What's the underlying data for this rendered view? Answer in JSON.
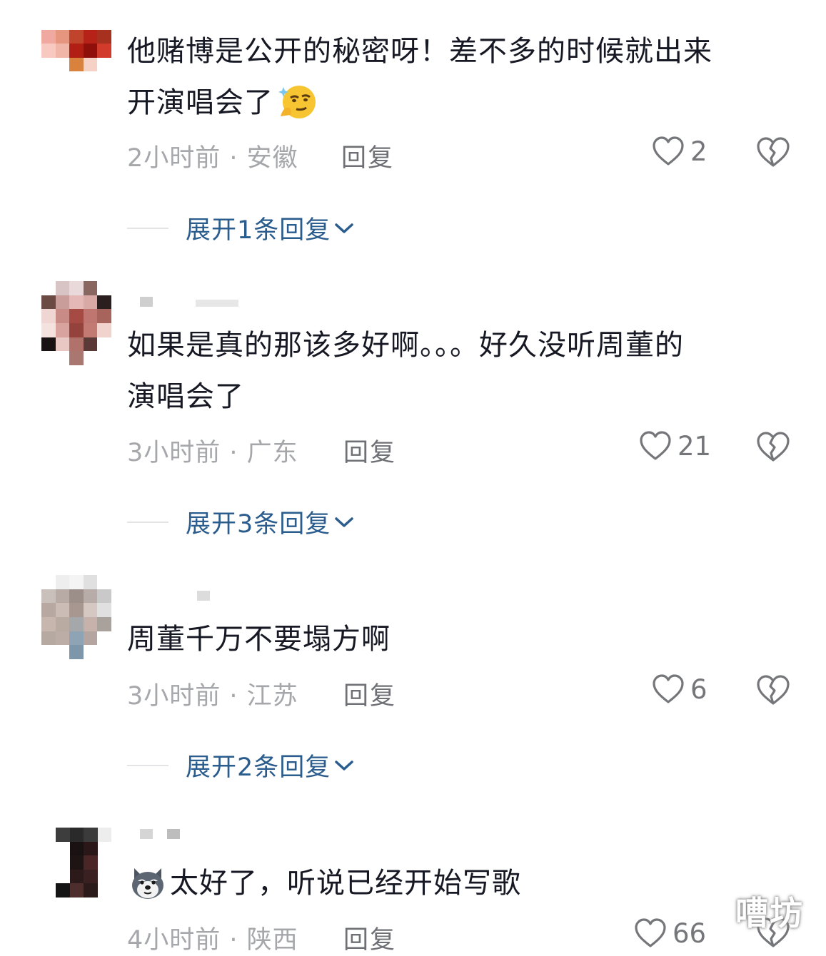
{
  "comments": [
    {
      "text_line1": "他赌博是公开的秘密呀！差不多的时候就出来",
      "text_line2": "开演唱会了",
      "meta": "2小时前 · 安徽",
      "reply": "回复",
      "likes": "2",
      "expand": "展开1条回复",
      "emoji": "thinking-face-emoji"
    },
    {
      "text_line1": "如果是真的那该多好啊。。。好久没听周董的",
      "text_line2": "演唱会了",
      "meta": "3小时前 · 广东",
      "reply": "回复",
      "likes": "21",
      "expand": "展开3条回复"
    },
    {
      "text_line1": "周董千万不要塌方啊",
      "meta": "3小时前 · 江苏",
      "reply": "回复",
      "likes": "6",
      "expand": "展开2条回复"
    },
    {
      "text_line1": "太好了，听说已经开始写歌",
      "meta": "4小时前 · 陕西",
      "reply": "回复",
      "likes": "66",
      "emoji": "husky-dog-emoji"
    }
  ],
  "watermark": "嘈坊",
  "colors": {
    "text": "#161823",
    "meta": "#a6a7ab",
    "link": "#2a5c8d",
    "icon": "#75767a"
  }
}
